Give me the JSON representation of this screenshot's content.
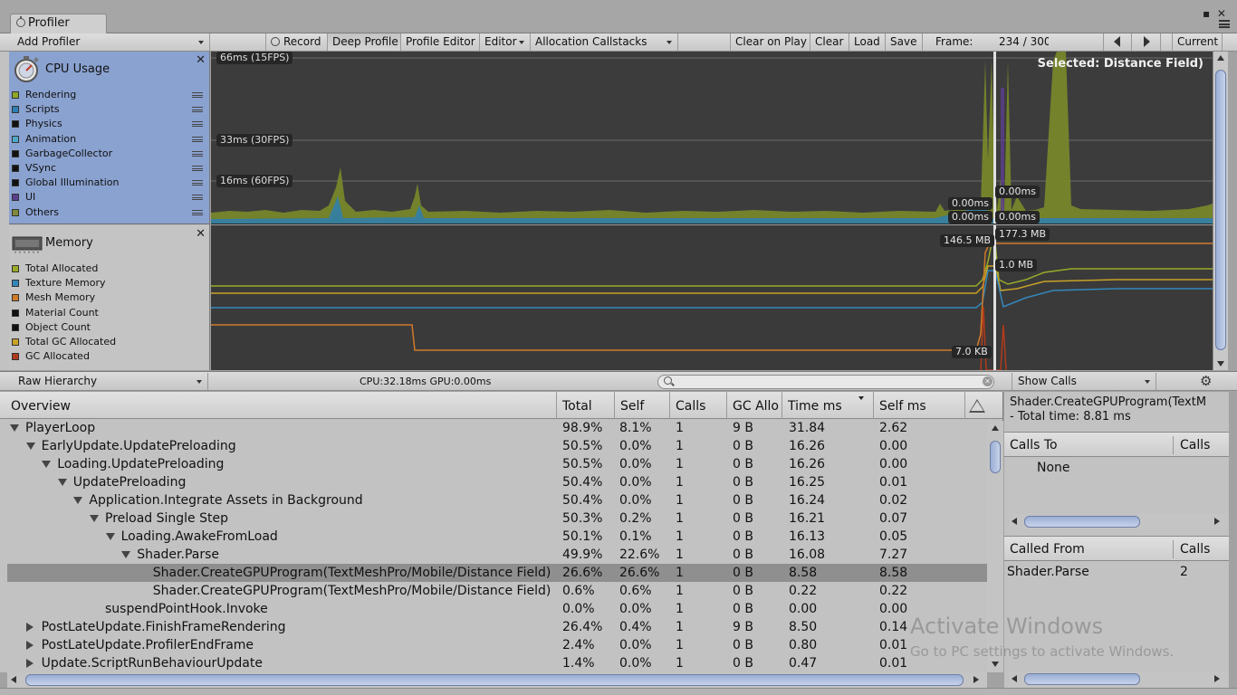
{
  "window": {
    "tab_title": "Profiler",
    "controls": "▪ ✕"
  },
  "toolbar": {
    "add_profiler": "Add Profiler",
    "record": "Record",
    "deep_profile": "Deep Profile",
    "profile_editor": "Profile Editor",
    "editor": "Editor",
    "allocation_callstacks": "Allocation Callstacks",
    "clear_on_play": "Clear on Play",
    "clear": "Clear",
    "load": "Load",
    "save": "Save",
    "frame_label": "Frame:",
    "frame_value": "234 / 300",
    "current": "Current"
  },
  "cpu_module": {
    "title": "CPU Usage",
    "close": "✕",
    "legend": [
      {
        "label": "Rendering",
        "color": "#8fa828"
      },
      {
        "label": "Scripts",
        "color": "#2e7fb3"
      },
      {
        "label": "Physics",
        "color": "#111111"
      },
      {
        "label": "Animation",
        "color": "#4ea9c9"
      },
      {
        "label": "GarbageCollector",
        "color": "#111111"
      },
      {
        "label": "VSync",
        "color": "#111111"
      },
      {
        "label": "Global Illumination",
        "color": "#111111"
      },
      {
        "label": "UI",
        "color": "#5a3f8f"
      },
      {
        "label": "Others",
        "color": "#7f8a3a"
      }
    ]
  },
  "memory_module": {
    "title": "Memory",
    "close": "✕",
    "legend": [
      {
        "label": "Total Allocated",
        "color": "#9aaa28"
      },
      {
        "label": "Texture Memory",
        "color": "#3388bb"
      },
      {
        "label": "Mesh Memory",
        "color": "#d07a28"
      },
      {
        "label": "Material Count",
        "color": "#111111"
      },
      {
        "label": "Object Count",
        "color": "#111111"
      },
      {
        "label": "Total GC Allocated",
        "color": "#c9a227"
      },
      {
        "label": "GC Allocated",
        "color": "#b03a1a"
      }
    ]
  },
  "cpu_graph": {
    "lines": [
      "66ms (15FPS)",
      "33ms (30FPS)",
      "16ms (60FPS)"
    ],
    "selected": "Selected: Distance Field)",
    "values_left": [
      "0.00ms",
      "0.00ms"
    ],
    "values_right": [
      "0.00ms",
      "0.00ms"
    ]
  },
  "memory_graph": {
    "value_left_top": "146.5 MB",
    "value_right_top": "177.3 MB",
    "value_right_mid": "1.0 MB",
    "value_left_bottom": "7.0 KB"
  },
  "hierarchy_toolbar": {
    "view": "Raw Hierarchy",
    "cpu_gpu": "CPU:32.18ms   GPU:0.00ms",
    "search_placeholder": "",
    "show_calls": "Show Calls",
    "gear": "⚙"
  },
  "table": {
    "columns": [
      "Overview",
      "Total",
      "Self",
      "Calls",
      "GC Allo",
      "Time ms",
      "Self ms"
    ],
    "rows": [
      {
        "name": "PlayerLoop",
        "indent": 0,
        "tri": "open",
        "total": "98.9%",
        "self": "8.1%",
        "calls": "1",
        "gc": "9 B",
        "time": "31.84",
        "selfms": "2.62"
      },
      {
        "name": "EarlyUpdate.UpdatePreloading",
        "indent": 1,
        "tri": "open",
        "total": "50.5%",
        "self": "0.0%",
        "calls": "1",
        "gc": "0 B",
        "time": "16.26",
        "selfms": "0.00"
      },
      {
        "name": "Loading.UpdatePreloading",
        "indent": 2,
        "tri": "open",
        "total": "50.5%",
        "self": "0.0%",
        "calls": "1",
        "gc": "0 B",
        "time": "16.26",
        "selfms": "0.00"
      },
      {
        "name": "UpdatePreloading",
        "indent": 3,
        "tri": "open",
        "total": "50.4%",
        "self": "0.0%",
        "calls": "1",
        "gc": "0 B",
        "time": "16.25",
        "selfms": "0.01"
      },
      {
        "name": "Application.Integrate Assets in Background",
        "indent": 4,
        "tri": "open",
        "total": "50.4%",
        "self": "0.0%",
        "calls": "1",
        "gc": "0 B",
        "time": "16.24",
        "selfms": "0.02"
      },
      {
        "name": "Preload Single Step",
        "indent": 5,
        "tri": "open",
        "total": "50.3%",
        "self": "0.2%",
        "calls": "1",
        "gc": "0 B",
        "time": "16.21",
        "selfms": "0.07"
      },
      {
        "name": "Loading.AwakeFromLoad",
        "indent": 6,
        "tri": "open",
        "total": "50.1%",
        "self": "0.1%",
        "calls": "1",
        "gc": "0 B",
        "time": "16.13",
        "selfms": "0.05"
      },
      {
        "name": "Shader.Parse",
        "indent": 7,
        "tri": "open",
        "total": "49.9%",
        "self": "22.6%",
        "calls": "1",
        "gc": "0 B",
        "time": "16.08",
        "selfms": "7.27"
      },
      {
        "name": "Shader.CreateGPUProgram(TextMeshPro/Mobile/Distance Field)",
        "indent": 8,
        "tri": "none",
        "selected": true,
        "total": "26.6%",
        "self": "26.6%",
        "calls": "1",
        "gc": "0 B",
        "time": "8.58",
        "selfms": "8.58"
      },
      {
        "name": "Shader.CreateGPUProgram(TextMeshPro/Mobile/Distance Field)",
        "indent": 8,
        "tri": "none",
        "total": "0.6%",
        "self": "0.6%",
        "calls": "1",
        "gc": "0 B",
        "time": "0.22",
        "selfms": "0.22"
      },
      {
        "name": "suspendPointHook.Invoke",
        "indent": 5,
        "tri": "none",
        "total": "0.0%",
        "self": "0.0%",
        "calls": "1",
        "gc": "0 B",
        "time": "0.00",
        "selfms": "0.00"
      },
      {
        "name": "PostLateUpdate.FinishFrameRendering",
        "indent": 1,
        "tri": "closed",
        "total": "26.4%",
        "self": "0.4%",
        "calls": "1",
        "gc": "9 B",
        "time": "8.50",
        "selfms": "0.14"
      },
      {
        "name": "PostLateUpdate.ProfilerEndFrame",
        "indent": 1,
        "tri": "closed",
        "total": "2.4%",
        "self": "0.0%",
        "calls": "1",
        "gc": "0 B",
        "time": "0.80",
        "selfms": "0.01"
      },
      {
        "name": "Update.ScriptRunBehaviourUpdate",
        "indent": 1,
        "tri": "closed",
        "total": "1.4%",
        "self": "0.0%",
        "calls": "1",
        "gc": "0 B",
        "time": "0.47",
        "selfms": "0.01"
      }
    ]
  },
  "details": {
    "title_line1": "Shader.CreateGPUProgram(TextM",
    "title_line2": " - Total time: 8.81 ms",
    "calls_to_header": "Calls To",
    "calls_header": "Calls",
    "calls_to_value": "None",
    "called_from_header": "Called From",
    "called_from_calls_header": "Calls",
    "called_from_name": "Shader.Parse",
    "called_from_calls": "2"
  },
  "watermark": {
    "title": "Activate Windows",
    "subtitle": "Go to PC settings to activate Windows."
  }
}
